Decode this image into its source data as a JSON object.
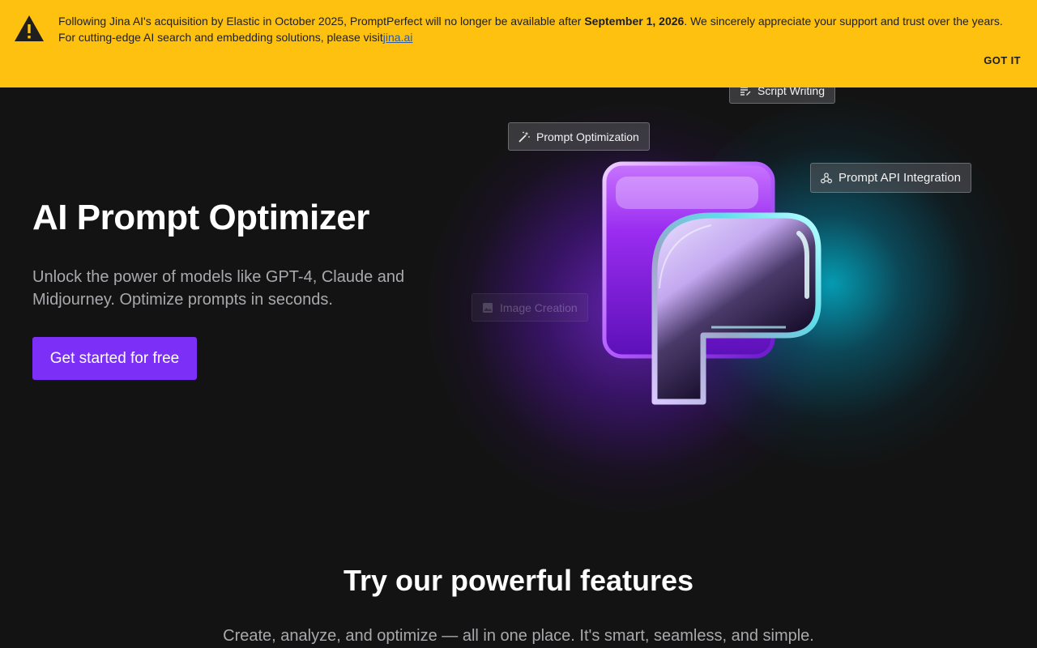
{
  "banner": {
    "text_before": "Following Jina AI's acquisition by Elastic in October 2025, PromptPerfect will no longer be available after ",
    "date": "September 1, 2026",
    "text_after": ". We sincerely appreciate your support and trust over the years. For cutting-edge AI search and embedding solutions, please visit",
    "link_text": "jina.ai",
    "dismiss_label": "GOT IT",
    "icon": "warning-icon"
  },
  "hero": {
    "title": "AI Prompt Optimizer",
    "subtitle": "Unlock the power of models like GPT-4, Claude and Midjourney. Optimize prompts in seconds.",
    "cta_label": "Get started for free"
  },
  "chips": {
    "script_writing": {
      "label": "Script Writing",
      "icon": "script-icon"
    },
    "prompt_optimization": {
      "label": "Prompt Optimization",
      "icon": "magic-wand-icon"
    },
    "api_integration": {
      "label": "Prompt API Integration",
      "icon": "webhook-icon"
    },
    "image_creation": {
      "label": "Image Creation",
      "icon": "image-icon"
    }
  },
  "features": {
    "title": "Try our powerful features",
    "subtitle": "Create, analyze, and optimize — all in one place. It's smart, seamless, and simple."
  },
  "colors": {
    "banner_bg": "#fec110",
    "page_bg": "#131313",
    "cta_bg": "#7b2ff7",
    "glow_purple": "#8028e6",
    "glow_cyan": "#00c8e6"
  }
}
